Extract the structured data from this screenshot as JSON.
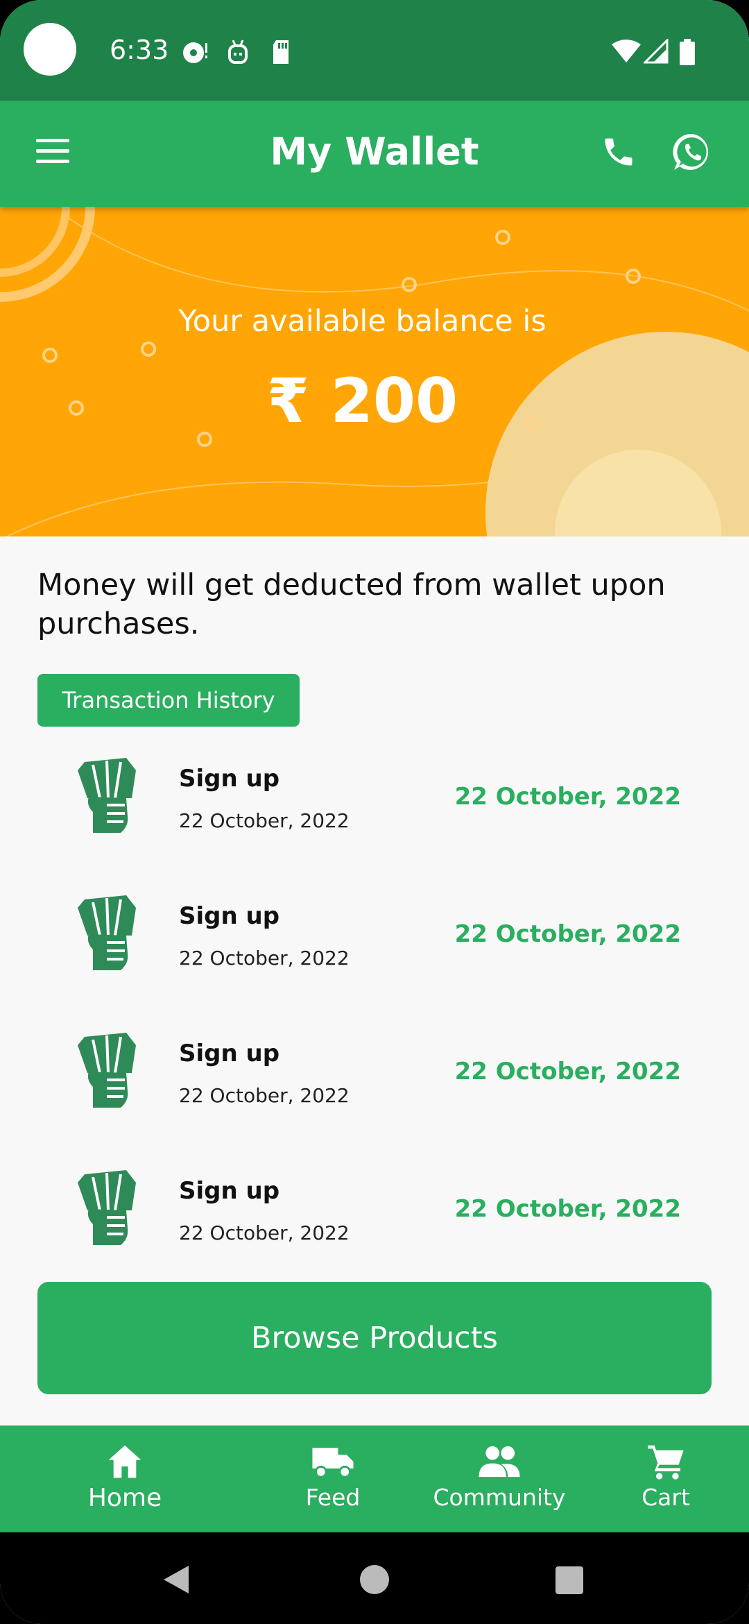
{
  "status_bar": {
    "time": "6:33",
    "icons": [
      "camera-dot",
      "record-icon",
      "android-icon",
      "sd-card-icon",
      "wifi-icon",
      "signal-icon",
      "battery-icon"
    ]
  },
  "app_bar": {
    "title": "My Wallet",
    "icons": [
      "menu-icon",
      "phone-icon",
      "whatsapp-icon"
    ]
  },
  "balance": {
    "label": "Your available balance is",
    "amount": "₹ 200"
  },
  "note": "Money will get deducted from wallet upon purchases.",
  "history_button": "Transaction History",
  "transactions": [
    {
      "title": "Sign up",
      "date": "22 October, 2022",
      "right_text": "22 October, 2022"
    },
    {
      "title": "Sign up",
      "date": "22 October, 2022",
      "right_text": "22 October, 2022"
    },
    {
      "title": "Sign up",
      "date": "22 October, 2022",
      "right_text": "22 October, 2022"
    },
    {
      "title": "Sign up",
      "date": "22 October, 2022",
      "right_text": "22 October, 2022"
    }
  ],
  "browse_button": "Browse Products",
  "bottom_nav": [
    {
      "label": "Home",
      "icon": "home-icon"
    },
    {
      "label": "Feed",
      "icon": "truck-icon"
    },
    {
      "label": "Community",
      "icon": "people-icon"
    },
    {
      "label": "Cart",
      "icon": "cart-icon"
    }
  ],
  "colors": {
    "status_bar": "#1f8349",
    "primary": "#2aae5f",
    "banner": "#ffa506",
    "background": "#f8f8f8"
  }
}
